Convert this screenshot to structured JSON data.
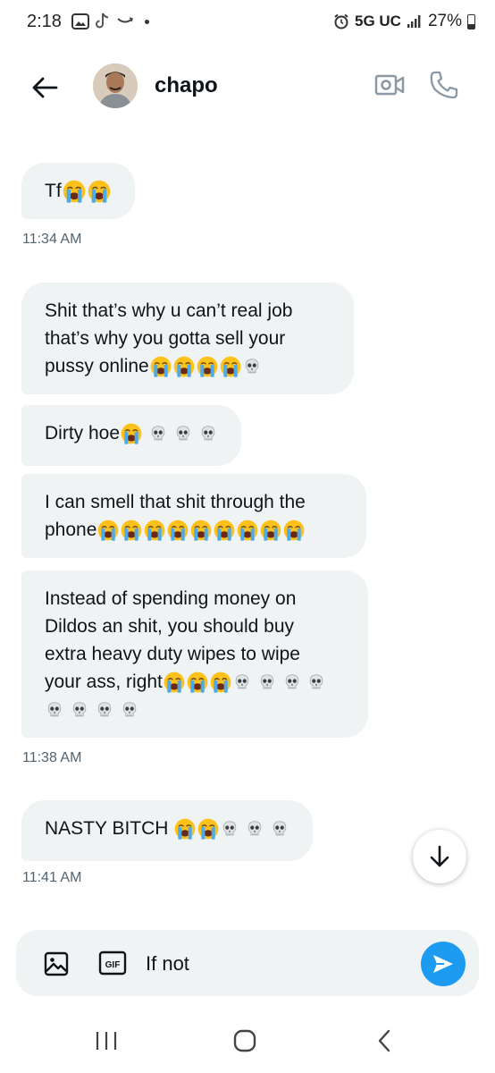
{
  "status_bar": {
    "time": "2:18",
    "network": "5G UC",
    "battery": "27%",
    "battery_level": 0.27
  },
  "header": {
    "contact_name": "chapo",
    "icons": {
      "back": "arrow-left-icon",
      "video": "video-call-icon",
      "call": "phone-call-icon"
    }
  },
  "messages": [
    {
      "text": "Tf",
      "emojis": [
        "sob",
        "sob"
      ]
    },
    {
      "timestamp": "11:34 AM"
    },
    {
      "lines": [
        "Shit  that’s why u can’t real job",
        "that’s why you gotta sell  your",
        "pussy online"
      ],
      "emojis": [
        "sob",
        "sob",
        "sob",
        "sob",
        "skull"
      ]
    },
    {
      "text": "Dirty hoe",
      "emojis": [
        "sob",
        "skull",
        "skull",
        "skull"
      ]
    },
    {
      "lines": [
        "I can smell that shit through the",
        "phone"
      ],
      "emojis": [
        "sob",
        "sob",
        "sob",
        "sob",
        "sob",
        "sob",
        "sob",
        "sob",
        "sob"
      ]
    },
    {
      "lines": [
        "Instead of spending money on",
        "Dildos an  shit, you should buy",
        "extra heavy duty wipes to wipe",
        "your ass, right"
      ],
      "emojis": [
        "sob",
        "sob",
        "sob",
        "skull",
        "skull",
        "skull",
        "skull"
      ],
      "emojis_line2": [
        "skull",
        "skull",
        "skull",
        "skull"
      ]
    },
    {
      "timestamp": "11:38 AM"
    },
    {
      "text": "NASTY BITCH ",
      "emojis": [
        "sob",
        "sob",
        "skull",
        "skull",
        "skull"
      ]
    },
    {
      "timestamp": "11:41 AM"
    }
  ],
  "text": {
    "msg1": "Tf",
    "ts1": "11:34 AM",
    "msg2_l1": "Shit  that’s why u can’t real job",
    "msg2_l2": "that’s why you gotta sell  your",
    "msg2_l3": "pussy online",
    "msg3": "Dirty hoe",
    "msg4_l1": "I can smell that shit through the",
    "msg4_l2": "phone",
    "msg5_l1": "Instead of spending money on",
    "msg5_l2": "Dildos an  shit, you should buy",
    "msg5_l3": "extra heavy duty wipes to wipe",
    "msg5_l4": "your ass, right",
    "ts2": "11:38 AM",
    "msg6": "NASTY BITCH ",
    "ts3": "11:41 AM"
  },
  "composer": {
    "value": "If not",
    "gif_label": "GIF",
    "icons": {
      "image": "image-icon",
      "gif": "gif-icon",
      "send": "send-icon"
    }
  },
  "colors": {
    "accent": "#1d9bf0",
    "bubble": "#eff3f4",
    "timestamp": "#536471"
  }
}
